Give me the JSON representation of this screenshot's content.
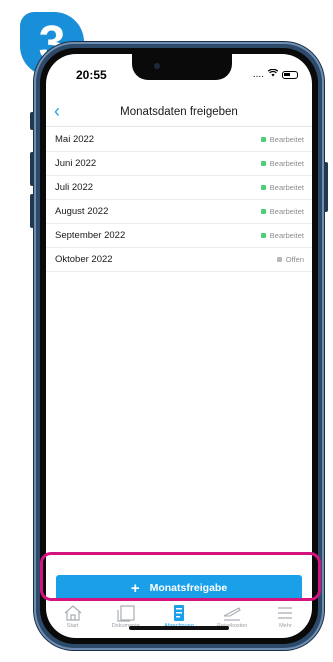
{
  "badge": {
    "step": "3"
  },
  "status_bar": {
    "time": "20:55",
    "signal": "....",
    "wifi": "ᯤ"
  },
  "navbar": {
    "back_glyph": "‹",
    "title": "Monatsdaten freigeben"
  },
  "months": [
    {
      "month": "Mai 2022",
      "status": "Bearbeitet",
      "color": "#4cce7a"
    },
    {
      "month": "Juni 2022",
      "status": "Bearbeitet",
      "color": "#4cce7a"
    },
    {
      "month": "Juli 2022",
      "status": "Bearbeitet",
      "color": "#4cce7a"
    },
    {
      "month": "August 2022",
      "status": "Bearbeitet",
      "color": "#4cce7a"
    },
    {
      "month": "September 2022",
      "status": "Bearbeitet",
      "color": "#4cce7a"
    },
    {
      "month": "Oktober 2022",
      "status": "Offen",
      "color": "#b8b8b8"
    }
  ],
  "cta": {
    "plus": "+",
    "label": "Monatsfreigabe"
  },
  "tabs": [
    {
      "label": "Start",
      "icon": "home-icon"
    },
    {
      "label": "Dokumente",
      "icon": "documents-icon"
    },
    {
      "label": "Abrechnung",
      "icon": "billing-icon"
    },
    {
      "label": "Reisekosten",
      "icon": "travel-icon"
    },
    {
      "label": "Mehr",
      "icon": "menu-icon"
    }
  ],
  "colors": {
    "accent": "#1aa0e8",
    "highlight": "#d4137e",
    "badge": "#1a8fd9"
  }
}
